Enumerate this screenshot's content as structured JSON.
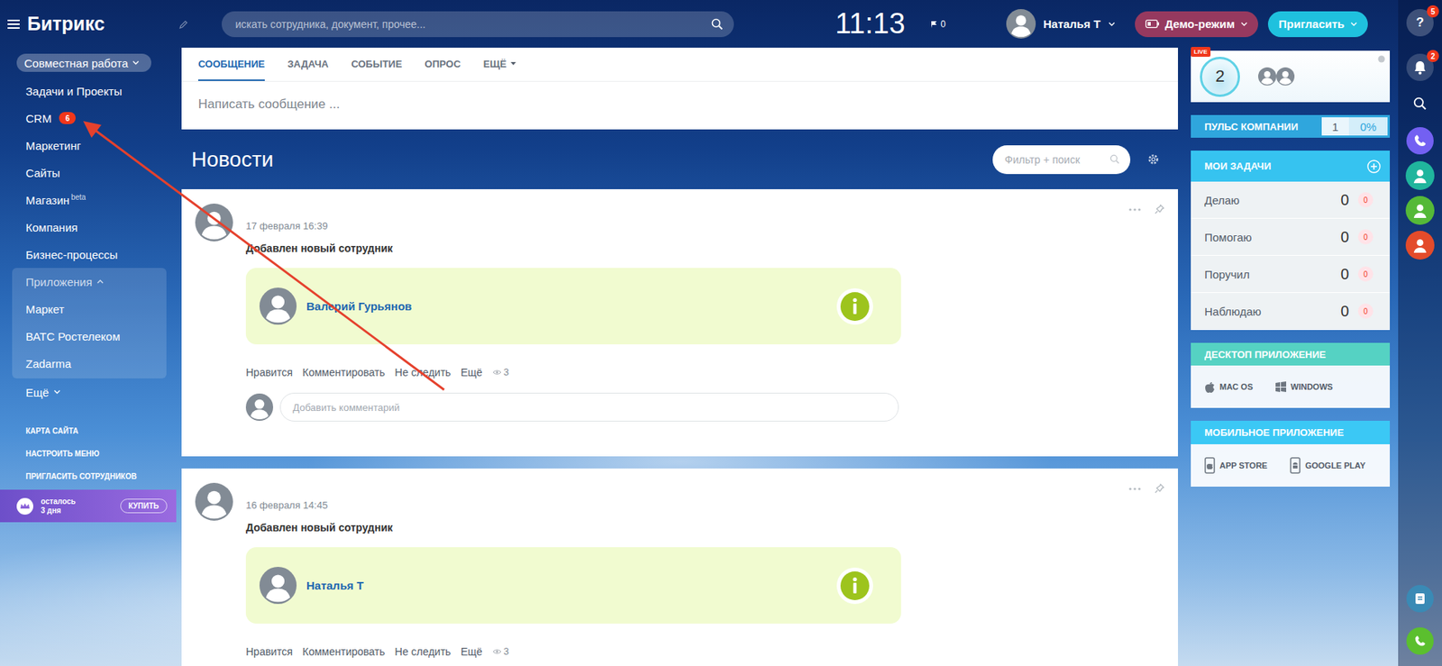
{
  "header": {
    "logo": "Битрикс",
    "search_placeholder": "искать сотрудника, документ, прочее...",
    "clock": "11:13",
    "flag_count": "0",
    "user": "Наталья Т",
    "demo_button": "Демо-режим",
    "invite_button": "Пригласить"
  },
  "sidebar": {
    "group": "Совместная работа",
    "items": [
      {
        "label": "Задачи и Проекты"
      },
      {
        "label": "CRM",
        "badge": "6"
      },
      {
        "label": "Маркетинг"
      },
      {
        "label": "Сайты"
      },
      {
        "label": "Магазин",
        "sup": "beta"
      },
      {
        "label": "Компания"
      },
      {
        "label": "Бизнес-процессы"
      }
    ],
    "apps": {
      "label": "Приложения",
      "expanded": true,
      "items": [
        "Маркет",
        "ВАТС Ростелеком",
        "Zadarma"
      ]
    },
    "more": "Ещё",
    "links": [
      "КАРТА САЙТА",
      "НАСТРОИТЬ МЕНЮ",
      "ПРИГЛАСИТЬ СОТРУДНИКОВ"
    ],
    "trial": {
      "line1": "осталось",
      "line2": "3 дня",
      "button": "КУПИТЬ"
    }
  },
  "composer": {
    "tabs": [
      {
        "label": "СООБЩЕНИЕ",
        "selected": true
      },
      {
        "label": "ЗАДАЧА",
        "selected": false
      },
      {
        "label": "СОБЫТИЕ",
        "selected": false
      },
      {
        "label": "ОПРОС",
        "selected": false
      },
      {
        "label": "ЕЩЁ",
        "selected": false,
        "dropdown": true
      }
    ],
    "placeholder": "Написать сообщение ..."
  },
  "feed": {
    "title": "Новости",
    "filter_placeholder": "Фильтр + поиск",
    "posts": [
      {
        "date": "17 февраля 16:39",
        "title": "Добавлен новый сотрудник",
        "person": "Валерий Гурьянов",
        "actions": [
          "Нравится",
          "Комментировать",
          "Не следить",
          "Ещё"
        ],
        "views": "3",
        "comment_placeholder": "Добавить комментарий"
      },
      {
        "date": "16 февраля 14:45",
        "title": "Добавлен новый сотрудник",
        "person": "Наталья Т",
        "actions": [
          "Нравится",
          "Комментировать",
          "Не следить",
          "Ещё"
        ],
        "views": "3"
      }
    ]
  },
  "right_panel": {
    "live": {
      "badge": "LIVE",
      "count": "2"
    },
    "pulse": {
      "label": "ПУЛЬС КОМПАНИИ",
      "value": "1",
      "percent": "0%"
    },
    "tasks": {
      "title": "МОИ ЗАДАЧИ",
      "rows": [
        {
          "label": "Делаю",
          "count": "0",
          "counter": "0"
        },
        {
          "label": "Помогаю",
          "count": "0",
          "counter": "0"
        },
        {
          "label": "Поручил",
          "count": "0",
          "counter": "0"
        },
        {
          "label": "Наблюдаю",
          "count": "0",
          "counter": "0"
        }
      ]
    },
    "desktop": {
      "title": "ДЕСКТОП ПРИЛОЖЕНИЕ",
      "apps": [
        "MAC OS",
        "WINDOWS"
      ]
    },
    "mobile": {
      "title": "МОБИЛЬНОЕ ПРИЛОЖЕНИЕ",
      "apps": [
        "APP STORE",
        "GOOGLE PLAY"
      ]
    }
  },
  "right_strip": {
    "help": "?",
    "help_badge": "5",
    "notify_badge": "2",
    "contacts": [
      {
        "color": "#20b59d"
      },
      {
        "color": "#55b938"
      },
      {
        "color": "#e34b2b"
      }
    ]
  }
}
